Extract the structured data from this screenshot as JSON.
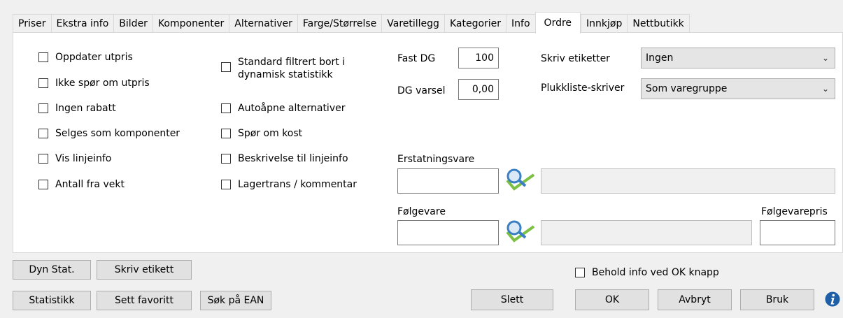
{
  "tabs": [
    "Priser",
    "Ekstra info",
    "Bilder",
    "Komponenter",
    "Alternativer",
    "Farge/Størrelse",
    "Varetillegg",
    "Kategorier",
    "Info",
    "Ordre",
    "Innkjøp",
    "Nettbutikk"
  ],
  "active_tab": "Ordre",
  "checkboxes_left": [
    "Oppdater utpris",
    "Ikke spør om utpris",
    "Ingen rabatt",
    "Selges som komponenter",
    "Vis linjeinfo",
    "Antall fra vekt"
  ],
  "checkboxes_mid": {
    "standard_line1": "Standard filtrert bort i",
    "standard_line2": "dynamisk statistikk",
    "items": [
      "Autoåpne alternativer",
      "Spør om kost",
      "Beskrivelse til linjeinfo",
      "Lagertrans / kommentar"
    ]
  },
  "fields": {
    "fast_dg_label": "Fast DG",
    "fast_dg_value": "100",
    "dg_varsel_label": "DG varsel",
    "dg_varsel_value": "0,00",
    "skriv_etiketter_label": "Skriv etiketter",
    "skriv_etiketter_value": "Ingen",
    "plukkliste_label": "Plukkliste-skriver",
    "plukkliste_value": "Som varegruppe",
    "erstatningsvare_label": "Erstatningsvare",
    "erstatningsvare_value": "",
    "folgevare_label": "Følgevare",
    "folgevare_value": "",
    "folgevarepris_label": "Følgevarepris",
    "folgevarepris_value": ""
  },
  "buttons": {
    "dyn_stat": "Dyn Stat.",
    "skriv_etikett": "Skriv etikett",
    "statistikk": "Statistikk",
    "sett_favoritt": "Sett favoritt",
    "sok_ean": "Søk på EAN",
    "slett": "Slett",
    "ok": "OK",
    "avbryt": "Avbryt",
    "bruk": "Bruk"
  },
  "behold_info": "Behold info ved OK knapp",
  "colors": {
    "info_icon": "#1f5fa8",
    "lens": "#3a7fc4",
    "check": "#7cc043"
  }
}
